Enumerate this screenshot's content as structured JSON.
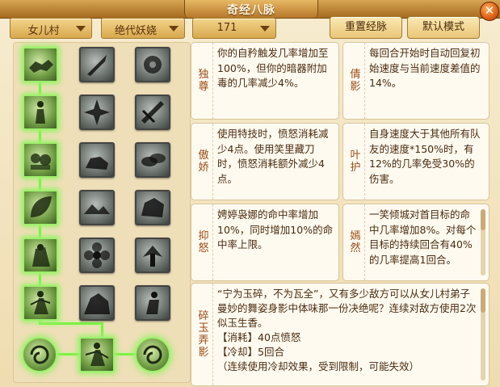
{
  "window": {
    "title": "奇经八脉"
  },
  "controls": {
    "faction": "女儿村",
    "style": "绝代妖娆",
    "level": "171",
    "reset_label": "重置经脉",
    "default_label": "默认模式"
  },
  "grid": {
    "column_1": [
      "handshake-icon",
      "meditating-figure-icon",
      "hands-gathering-icon",
      "leaf-icon",
      "cloaked-figure-icon",
      "dancer-icon"
    ],
    "column_2": [
      "dagger-icon",
      "shuriken-icon",
      "crouching-beast-icon",
      "landscape-icon",
      "flower-icon",
      "cave-icon"
    ],
    "column_3": [
      "blossom-icon",
      "sword-slash-icon",
      "clouds-icon",
      "rock-icon",
      "winged-figure-icon",
      "kneeling-figure-icon"
    ],
    "bottom": [
      "swirl-icon",
      "dancer-icon",
      "swirl-icon"
    ],
    "active_color": "#9df06c"
  },
  "skills": [
    {
      "name": "独尊",
      "desc": "你的自矜触发几率增加至100%，但你的暗器附加毒的几率减少4%。"
    },
    {
      "name": "倩影",
      "desc": "每回合开始时自动回复初始速度与当前速度差值的14%。"
    },
    {
      "name": "傲娇",
      "desc": "使用特技时，愤怒消耗减少4点。使用笑里藏刀时，愤怒消耗额外减少4点。"
    },
    {
      "name": "叶护",
      "desc": "自身速度大于其他所有队友的速度*150%时，有12%的几率免受30%的伤害。"
    },
    {
      "name": "抑怒",
      "desc": "娉婷袅娜的命中率增加10%，同时增加10%的命中率上限。"
    },
    {
      "name": "嫣然",
      "desc": "一笑倾城对首目标的命中几率增加8%。对每个目标的持续回合有40%的几率提高1回合。"
    }
  ],
  "detail": {
    "name": "碎玉弄影",
    "quote": "“宁为玉碎，不为瓦全”，又有多少敌方可以从女儿村弟子曼妙的舞姿身影中体味那一份决绝呢？连续对敌方使用2次似玉生香。",
    "cost_label": "【消耗】",
    "cost_value": "40点愤怒",
    "cooldown_label": "【冷却】",
    "cooldown_value": "5回合",
    "extra": "（连续使用冷却效果，受到限制，可能失效）"
  },
  "colors": {
    "title_bar": "#c2822e",
    "accent_text": "#9b4a12",
    "active_glow": "#9df06c"
  }
}
